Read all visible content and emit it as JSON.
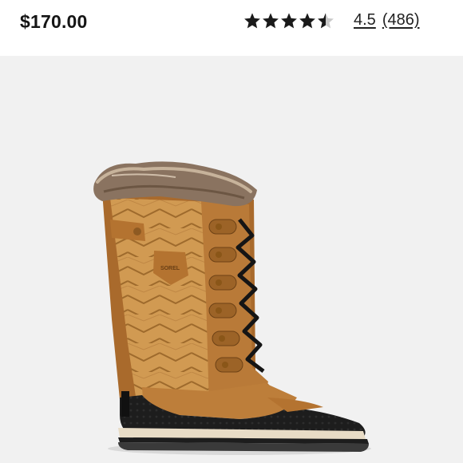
{
  "product": {
    "price": "$170.00",
    "rating_value": "4.5",
    "review_count": "(486)",
    "rating": 4.5,
    "rating_max": 5,
    "star_icon": "star-icon",
    "image_logo_text": "SOREL"
  },
  "colors": {
    "star": "#1a1a1a",
    "image_background": "#f1f1f1",
    "boot_tan": "#c98f49",
    "boot_leather": "#b47330",
    "boot_rubber": "#1c1c1c"
  }
}
